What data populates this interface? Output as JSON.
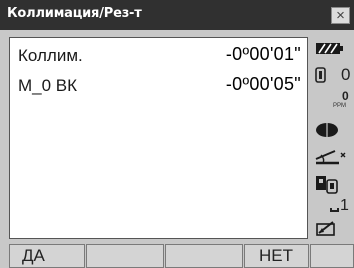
{
  "window": {
    "title": "Коллимация/Рез-т",
    "close_glyph": "×"
  },
  "results": [
    {
      "label": "Коллим.",
      "value": "-0º00'01\""
    },
    {
      "label": "M_0 ВК",
      "value": "-0º00'05\""
    }
  ],
  "status": {
    "battery_icon": "battery-full-icon",
    "prism_constant": "0",
    "ppm_value": "0",
    "ppm_unit": "PPM",
    "laser_icon": "laser-pointer-icon",
    "tilt_icon": "tilt-compensation-icon",
    "target_icon": "target-mode-icon",
    "face_label": "1",
    "input_icon": "input-mode-icon"
  },
  "softkeys": [
    "ДА",
    "",
    "",
    "НЕТ",
    ""
  ],
  "colors": {
    "titlebar": "#303030",
    "frame": "#c8c8c8",
    "panel": "#ffffff",
    "softkey": "#d4d4d4"
  }
}
